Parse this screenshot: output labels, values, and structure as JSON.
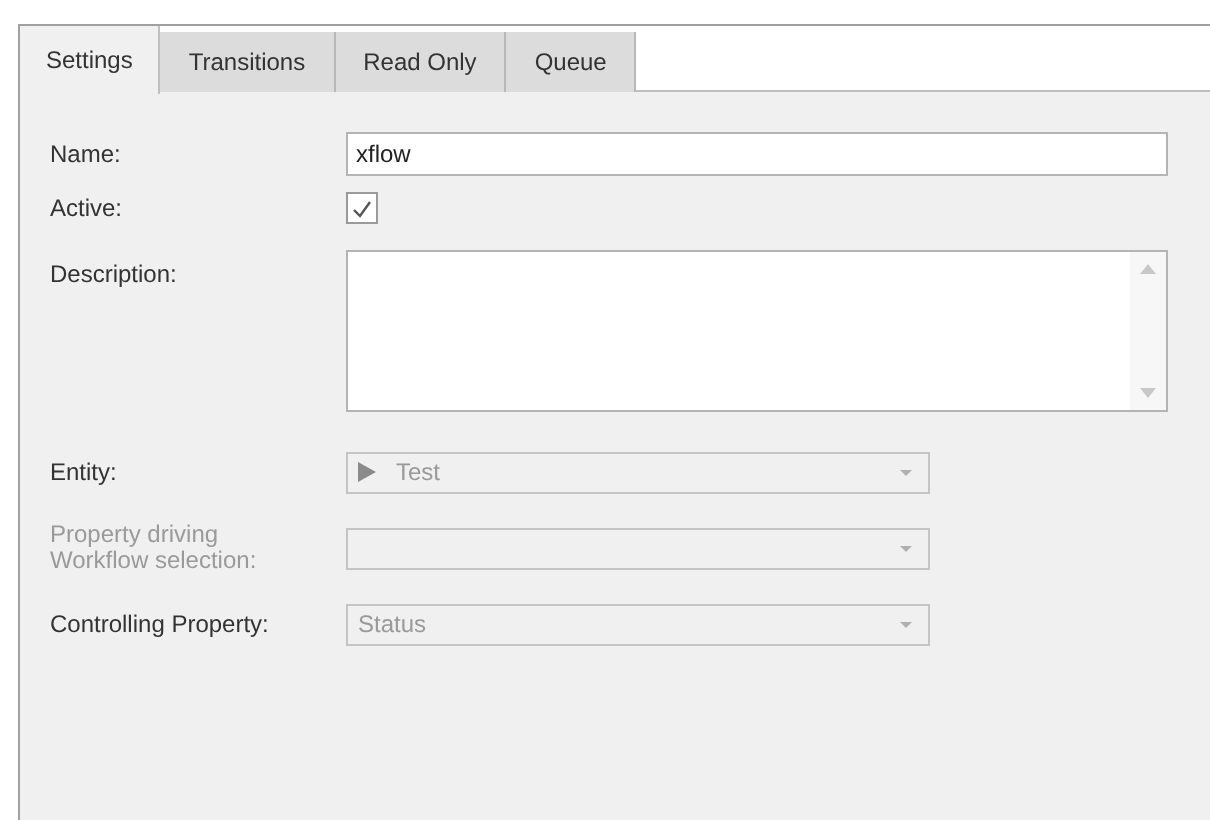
{
  "tabs": [
    {
      "label": "Settings",
      "selected": true
    },
    {
      "label": "Transitions",
      "selected": false
    },
    {
      "label": "Read Only",
      "selected": false
    },
    {
      "label": "Queue",
      "selected": false
    }
  ],
  "name": {
    "label": "Name:",
    "value": "xflow"
  },
  "active": {
    "label": "Active:",
    "checked": true
  },
  "description": {
    "label": "Description:"
  },
  "selectors": [
    {
      "label": "Entity:",
      "value": "Test",
      "disabled": false,
      "has_icon": true
    },
    {
      "label": "Property driving Workflow selection:",
      "disabled": true,
      "has_icon": false
    },
    {
      "label": "Controlling Property:",
      "value": "Status",
      "disabled": false,
      "has_icon": false
    }
  ]
}
